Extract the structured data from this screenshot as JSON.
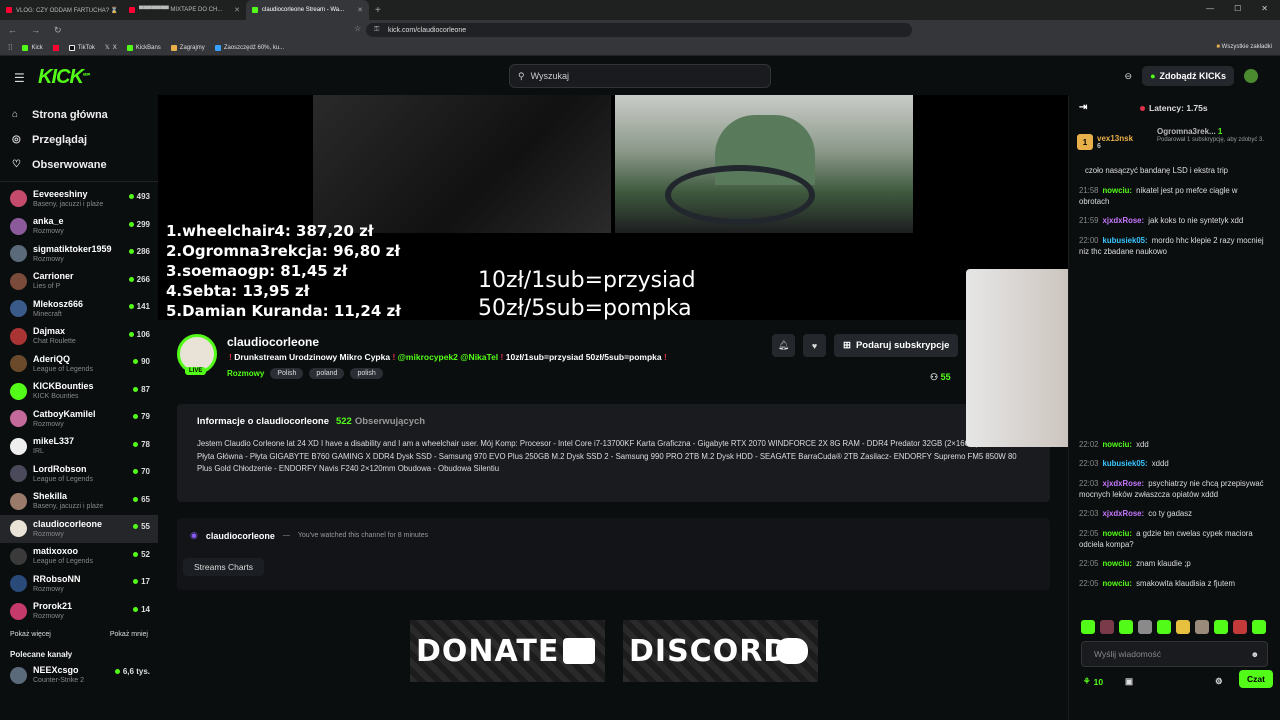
{
  "browser": {
    "tabs": [
      {
        "label": "VLOG: CZY ODDAM FARTUCHA? ⌛",
        "color": "#ff0033"
      },
      {
        "label": "▀▀▀▀▀▀▀ MIXTAPE DO CH...",
        "color": "#ff0033"
      },
      {
        "label": "claudiocorleone Stream - Wa...",
        "color": "#53fc18"
      }
    ],
    "url": "kick.com/claudiocorleone",
    "bookmarks": [
      "Kick",
      "TikTok",
      "X",
      "KickBans",
      "Zagrajmy",
      "Zaoszczędź 60%, ku..."
    ],
    "all_bookmarks": "Wszystkie zakładki"
  },
  "topbar": {
    "logo": "KICK",
    "logo_badge": "BETA",
    "search_placeholder": "Wyszukaj",
    "get_kicks": "Zdobądź KICKs"
  },
  "sidebar": {
    "nav": [
      {
        "label": "Strona główna",
        "icon": "home-icon"
      },
      {
        "label": "Przeglądaj",
        "icon": "compass-icon"
      },
      {
        "label": "Obserwowane",
        "icon": "heart-icon"
      }
    ],
    "channels": [
      {
        "name": "Eeveeeshiny",
        "category": "Baseny, jacuzzi i plaże",
        "viewers": "493",
        "color": "#c44b6c"
      },
      {
        "name": "anka_e",
        "category": "Rozmowy",
        "viewers": "299",
        "color": "#8a5a9a"
      },
      {
        "name": "sigmatiktoker1959",
        "category": "Rozmowy",
        "viewers": "286",
        "color": "#5a6a7a"
      },
      {
        "name": "Carrioner",
        "category": "Lies of P",
        "viewers": "266",
        "color": "#7a4a3a"
      },
      {
        "name": "Mlekosz666",
        "category": "Minecraft",
        "viewers": "141",
        "color": "#3a5a8a"
      },
      {
        "name": "Dajmax",
        "category": "Chat Roulette",
        "viewers": "106",
        "color": "#aa3333"
      },
      {
        "name": "AderiQQ",
        "category": "League of Legends",
        "viewers": "90",
        "color": "#6a4a2a"
      },
      {
        "name": "KICKBounties",
        "category": "KICK Bounties",
        "viewers": "87",
        "color": "#53fc18"
      },
      {
        "name": "CatboyKamilel",
        "category": "Rozmowy",
        "viewers": "79",
        "color": "#c46a9a"
      },
      {
        "name": "mikeL337",
        "category": "IRL",
        "viewers": "78",
        "color": "#eeeeee"
      },
      {
        "name": "LordRobson",
        "category": "League of Legends",
        "viewers": "70",
        "color": "#4a4a5a"
      },
      {
        "name": "Shekilla",
        "category": "Baseny, jacuzzi i plaże",
        "viewers": "65",
        "color": "#9a7a6a"
      },
      {
        "name": "claudiocorleone",
        "category": "Rozmowy",
        "viewers": "55",
        "color": "#e8e3d6"
      },
      {
        "name": "matixoxoo",
        "category": "League of Legends",
        "viewers": "52",
        "color": "#3a3a3a"
      },
      {
        "name": "RRobsoNN",
        "category": "Rozmowy",
        "viewers": "17",
        "color": "#2a4a7a"
      },
      {
        "name": "Prorok21",
        "category": "Rozmowy",
        "viewers": "14",
        "color": "#c43a6a"
      }
    ],
    "show_more": "Pokaż więcej",
    "show_less": "Pokaż mniej",
    "recommended_title": "Polecane kanały",
    "recommended": [
      {
        "name": "NEEXcsgo",
        "category": "Counter-Strike 2",
        "viewers": "6,6 tys.",
        "color": "#5a6a7a"
      }
    ]
  },
  "video": {
    "leaderboard": [
      "1.wheelchair4: 387,20 zł",
      "2.Ogromna3rekcja: 96,80 zł",
      "3.soemaogp: 81,45 zł",
      "4.Sebta: 13,95 zł",
      "5.Damian Kuranda: 11,24 zł"
    ],
    "overlay_line1": "10zł/1sub=przysiad",
    "overlay_line2": "50zł/5sub=pompka"
  },
  "channel": {
    "name": "claudiocorleone",
    "live_badge": "LIVE",
    "title_pre": "Drunkstream Urodzinowy Mikro Cypka",
    "title_mentions": "@mikrocypek2 @NikaTel",
    "title_post": "10zł/1sub=przysiad 50zł/5sub=pompka",
    "category": "Rozmowy",
    "tags": [
      "Polish",
      "poland",
      "polish"
    ],
    "gift_subs_label": "Podaruj subskrypcje",
    "viewers": "55",
    "about_title": "Informacje o claudiocorleone",
    "followers_count": "522",
    "followers_label": "Obserwujących",
    "bio": "Jestem Claudio Corleone lat 24 XD I have a disability and I am a wheelchair user. Mój Komp: Procesor - Intel Core i7-13700KF Karta Graficzna - Gigabyte RTX 2070 WINDFORCE 2X 8G RAM - DDR4 Predator 32GB (2×16GB)/3200 CL16 Płyta Główna - Płyta GIGABYTE B760 GAMING X DDR4 Dysk SSD - Samsung 970 EVO Plus 250GB M.2 Dysk SSD 2 - Samsung 990 PRO 2TB M.2 Dysk HDD - SEAGATE BarraCuda® 2TB Zasilacz- ENDORFY Supremo FM5 850W 80 Plus Gold Chłodzenie - ENDORFY Navis F240 2×120mm Obudowa - Obudowa Silentiu",
    "watch_name": "claudiocorleone",
    "watch_note": "You've watched this channel for 8 minutes",
    "streams_charts": "Streams Charts",
    "panels": [
      "DONATE",
      "DISCORD"
    ]
  },
  "chat": {
    "latency": "Latency: 1.75s",
    "pinned_user": "vex13nsk",
    "pinned_rank": "1",
    "pinned_count": "6",
    "pinned2_user": "Ogromna3rek...",
    "pinned2_count": "1",
    "pinned2_note": "Podarował 1 subskrypcję, aby zdobyć 3.",
    "messages": [
      {
        "time": "",
        "user": "",
        "text": "czoło nasączyć bandanę LSD i ekstra trip",
        "color": "#53fc18"
      },
      {
        "time": "21:58",
        "user": "nowciu:",
        "text": "nikatel jest po mefce ciągle w obrotach",
        "color": "#53fc18"
      },
      {
        "time": "21:59",
        "user": "xjxdxRose:",
        "text": "jak koks to nie syntetyk xdd",
        "color": "#c778ff"
      },
      {
        "time": "22:00",
        "user": "kubusiek05:",
        "text": "mordo hhc klepie 2 razy mocniej niz thc zbadane naukowo",
        "color": "#38c6ff"
      },
      {
        "time": "22:02",
        "user": "nowciu:",
        "text": "xdd",
        "color": "#53fc18"
      },
      {
        "time": "22:03",
        "user": "kubusiek05:",
        "text": "xddd",
        "color": "#38c6ff"
      },
      {
        "time": "22:03",
        "user": "xjxdxRose:",
        "text": "psychiatrzy nie chcą przepisywać mocnych leków zwłaszcza opiatów xddd",
        "color": "#c778ff"
      },
      {
        "time": "22:03",
        "user": "xjxdxRose:",
        "text": "co ty gadasz",
        "color": "#c778ff"
      },
      {
        "time": "22:05",
        "user": "nowciu:",
        "text": "a gdzie ten cwelas cypek maciora odciela kompa?",
        "color": "#53fc18"
      },
      {
        "time": "22:05",
        "user": "nowciu:",
        "text": "znam klaudie ;p",
        "color": "#53fc18"
      },
      {
        "time": "22:05",
        "user": "nowciu:",
        "text": "smakowita klaudisia z fjutem",
        "color": "#53fc18"
      }
    ],
    "input_placeholder": "Wyślij wiadomość",
    "points": "10",
    "send_label": "Czat"
  }
}
